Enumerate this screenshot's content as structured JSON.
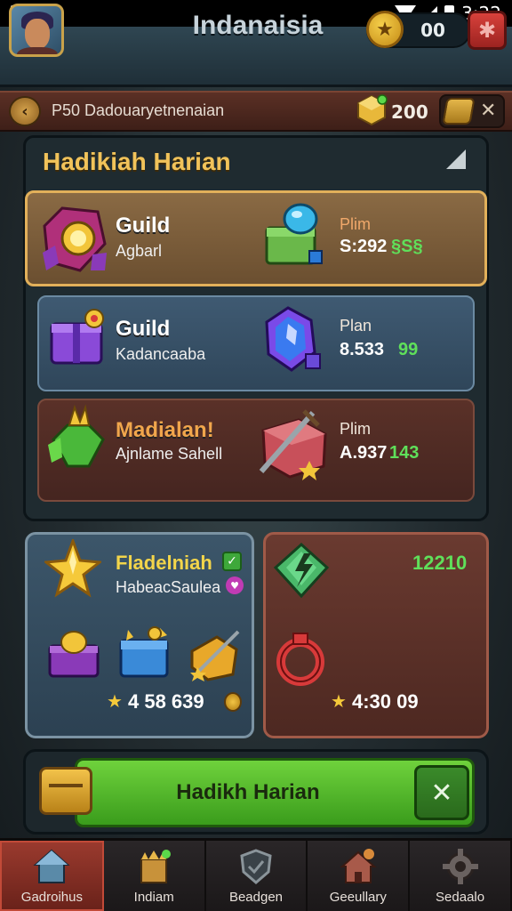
{
  "status_bar": {
    "time": "3:22"
  },
  "header": {
    "title": "Indanaisia",
    "coin_value": "00"
  },
  "sub_bar": {
    "text": "P50 Dadouaryetnenaian",
    "gem_value": "200"
  },
  "panel": {
    "title": "Hadikiah Harian",
    "rows": [
      {
        "name": "Guild",
        "sub": "Agbarl",
        "price_label": "Plim",
        "price_value": "S:292",
        "price_extra": "§S§"
      },
      {
        "name": "Guild",
        "sub": "Kadancaaba",
        "price_label": "Plan",
        "price_value": "8.533",
        "price_extra": "99"
      },
      {
        "name": "Madialan!",
        "sub": "Ajnlame Sahell",
        "price_label": "Plim",
        "price_value": "A.937",
        "price_extra": "143"
      }
    ]
  },
  "card_left": {
    "title": "Fladelniah",
    "sub": "HabeacSaulea",
    "value": "4 58 639"
  },
  "card_right": {
    "value": "12210",
    "total": "4:30 09"
  },
  "action": {
    "label": "Hadikh Harian"
  },
  "nav": [
    {
      "label": "Gadroihus",
      "active": true
    },
    {
      "label": "Indiam",
      "active": false
    },
    {
      "label": "Beadgen",
      "active": false
    },
    {
      "label": "Geeullary",
      "active": false
    },
    {
      "label": "Sedaalo",
      "active": false
    }
  ],
  "colors": {
    "accent_gold": "#f1c35a",
    "accent_green": "#5fe05a",
    "brand_red": "#d8413b"
  },
  "icons": [
    "search-icon",
    "coin-icon",
    "star-icon",
    "gem-icon",
    "chest-icon",
    "sword-icon",
    "close-icon",
    "back-icon"
  ]
}
